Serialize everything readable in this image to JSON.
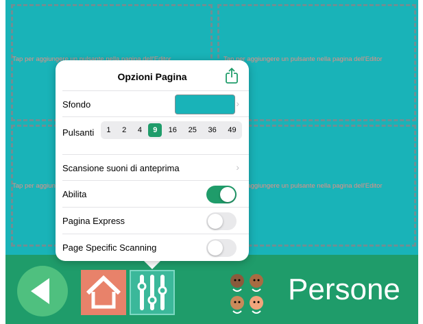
{
  "grid": {
    "hint_text": "Tap per aggiungere un pulsante nella pagina dell'Editor"
  },
  "popover": {
    "title": "Opzioni Pagina",
    "background": {
      "label": "Sfondo",
      "color": "#19b3b8"
    },
    "buttons": {
      "label": "Pulsanti",
      "options": [
        "1",
        "2",
        "4",
        "9",
        "16",
        "25",
        "36",
        "49"
      ],
      "selected": "9"
    },
    "scan_preview": {
      "label": "Scansione suoni di anteprima"
    },
    "enable": {
      "label": "Abilita",
      "on": true
    },
    "express_page": {
      "label": "Pagina Express",
      "on": false
    },
    "page_specific_scanning": {
      "label": "Page Specific Scanning",
      "on": false
    }
  },
  "bottom_bar": {
    "page_name": "Persone",
    "back_icon": "back-arrow-icon",
    "home_icon": "home-icon",
    "settings_icon": "sliders-icon",
    "people_icon": "people-icon"
  },
  "colors": {
    "page_background": "#19b3b8",
    "bar_background": "#1f9c6a",
    "accent": "#1f9c6a",
    "home_button": "#e8826a"
  }
}
